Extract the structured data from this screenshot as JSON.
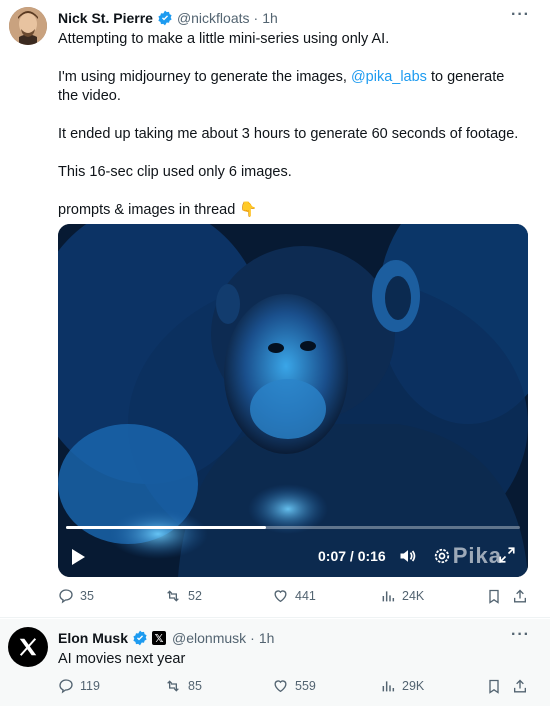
{
  "tweet": {
    "author_name": "Nick St. Pierre",
    "author_handle": "@nickfloats",
    "separator": "·",
    "time": "1h",
    "more": "···",
    "line1": "Attempting to make a little mini-series using only AI.",
    "line2_pre": "I'm using midjourney to generate the images, ",
    "line2_link": "@pika_labs",
    "line2_post": " to generate the video.",
    "line3": "It ended up taking me about 3 hours to generate 60 seconds of footage.",
    "line4": "This 16-sec clip used only 6 images.",
    "line5": "prompts & images in thread",
    "line5_emoji": "👇",
    "video": {
      "timecode": "0:07 / 0:16",
      "progress": 0.44,
      "watermark": "Pika"
    },
    "stats": {
      "replies": "35",
      "reposts": "52",
      "likes": "441",
      "views": "24K"
    }
  },
  "reply": {
    "author_name": "Elon Musk",
    "badge": "𝕏",
    "author_handle": "@elonmusk",
    "separator": "·",
    "time": "1h",
    "more": "···",
    "text": "AI movies next year",
    "stats": {
      "replies": "119",
      "reposts": "85",
      "likes": "559",
      "views": "29K"
    }
  },
  "colors": {
    "accent": "#1d9bf0",
    "muted": "#536471",
    "text": "#0f1419"
  }
}
